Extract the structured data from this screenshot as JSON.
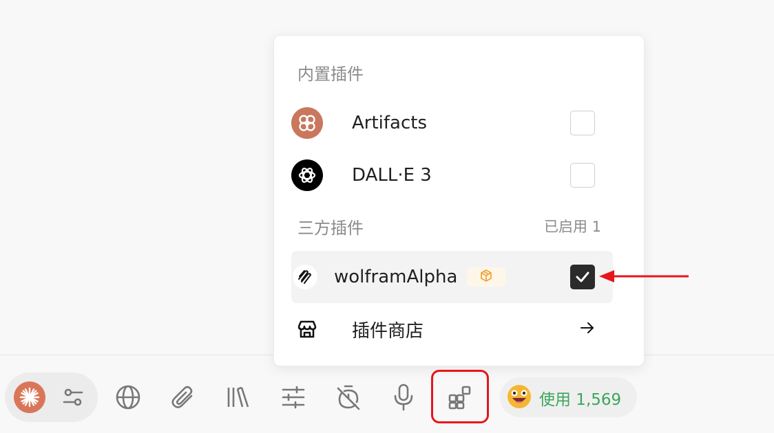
{
  "plugin_popup": {
    "builtin_title": "内置插件",
    "builtin_items": [
      {
        "label": "Artifacts",
        "checked": false,
        "icon": "flower-icon"
      },
      {
        "label": "DALL·E 3",
        "checked": false,
        "icon": "openai-icon"
      }
    ],
    "thirdparty_title": "三方插件",
    "enabled_count": "已启用 1",
    "thirdparty_items": [
      {
        "label": "wolframAlpha",
        "checked": true,
        "icon": "wolfram-icon",
        "badge_icon": "package-icon"
      }
    ],
    "store_label": "插件商店"
  },
  "toolbar": {
    "icons": [
      "model-icon",
      "settings-sliders-icon",
      "globe-icon",
      "paperclip-icon",
      "library-icon",
      "adjust-icon",
      "timer-off-icon",
      "microphone-icon",
      "plugins-icon"
    ],
    "usage_label": "使用 1,569"
  },
  "colors": {
    "accent_green": "#3aa65b",
    "annotation_red": "#e8141b",
    "artifacts_icon_bg": "#c9775d"
  }
}
